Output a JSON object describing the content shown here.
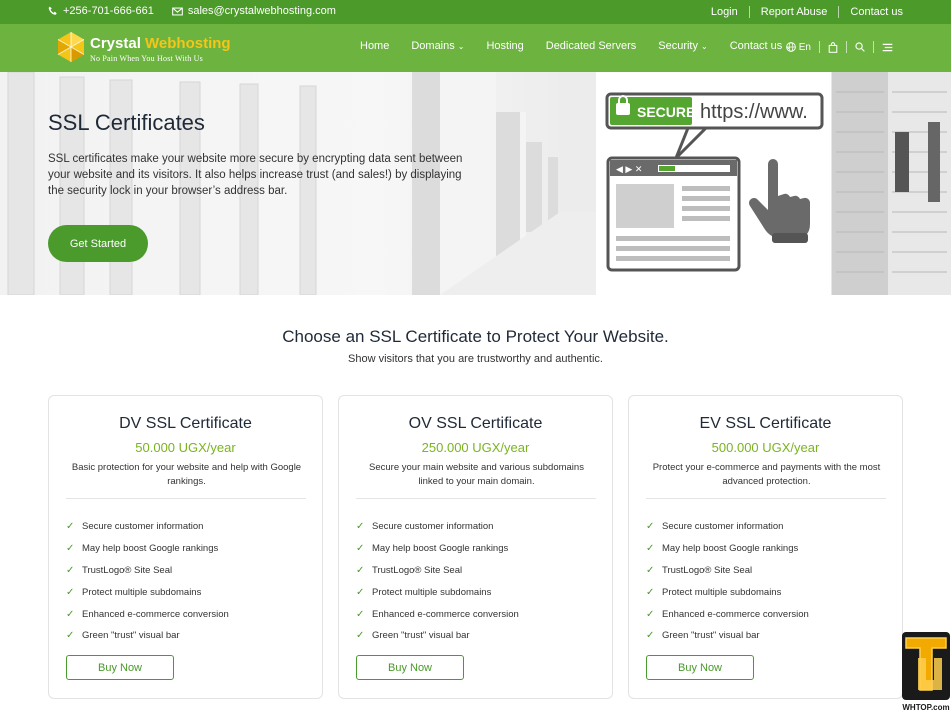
{
  "topbar": {
    "phone": "+256-701-666-661",
    "email": "sales@crystalwebhosting.com",
    "links": [
      "Login",
      "Report Abuse",
      "Contact us"
    ]
  },
  "logo": {
    "name_part1": "Crystal",
    "name_part2": "Webhosting",
    "tagline": "No Pain When You Host With Us"
  },
  "nav": {
    "items": [
      {
        "label": "Home",
        "dropdown": false
      },
      {
        "label": "Domains",
        "dropdown": true
      },
      {
        "label": "Hosting",
        "dropdown": false
      },
      {
        "label": "Dedicated Servers",
        "dropdown": false
      },
      {
        "label": "Security",
        "dropdown": true
      },
      {
        "label": "Contact us",
        "dropdown": true
      }
    ],
    "language": "En"
  },
  "hero": {
    "title": "SSL Certificates",
    "description": "SSL certificates make your website more secure by encrypting data sent between your website and its visitors. It also helps increase trust (and sales!) by displaying the security lock in your browser’s address bar.",
    "cta": "Get Started",
    "illustration": {
      "secure_label": "SECURE",
      "url_text": "https://www."
    }
  },
  "section": {
    "title": "Choose an SSL Certificate to Protect Your Website.",
    "subtitle": "Show visitors that you are trustworthy and authentic."
  },
  "plans": [
    {
      "name": "DV SSL Certificate",
      "price": "50.000 UGX/year",
      "description": "Basic protection for your website and help with Google rankings.",
      "features": [
        "Secure customer information",
        "May help boost Google rankings",
        "TrustLogo® Site Seal",
        "Protect multiple subdomains",
        "Enhanced e-commerce conversion",
        "Green \"trust\" visual bar"
      ],
      "button": "Buy Now"
    },
    {
      "name": "OV SSL Certificate",
      "price": "250.000 UGX/year",
      "description": "Secure your main website and various subdomains linked to your main domain.",
      "features": [
        "Secure customer information",
        "May help boost Google rankings",
        "TrustLogo® Site Seal",
        "Protect multiple subdomains",
        "Enhanced e-commerce conversion",
        "Green \"trust\" visual bar"
      ],
      "button": "Buy Now"
    },
    {
      "name": "EV SSL Certificate",
      "price": "500.000 UGX/year",
      "description": "Protect your e-commerce and payments with the most advanced protection.",
      "features": [
        "Secure customer information",
        "May help boost Google rankings",
        "TrustLogo® Site Seal",
        "Protect multiple subdomains",
        "Enhanced e-commerce conversion",
        "Green \"trust\" visual bar"
      ],
      "button": "Buy Now"
    }
  ],
  "badge": {
    "caption": "WHTOP.com"
  },
  "colors": {
    "topbar": "#4c9a2a",
    "header": "#6cb33f",
    "accent": "#4a9a2c",
    "price": "#7ab41f",
    "logo_yellow": "#f5c518"
  }
}
